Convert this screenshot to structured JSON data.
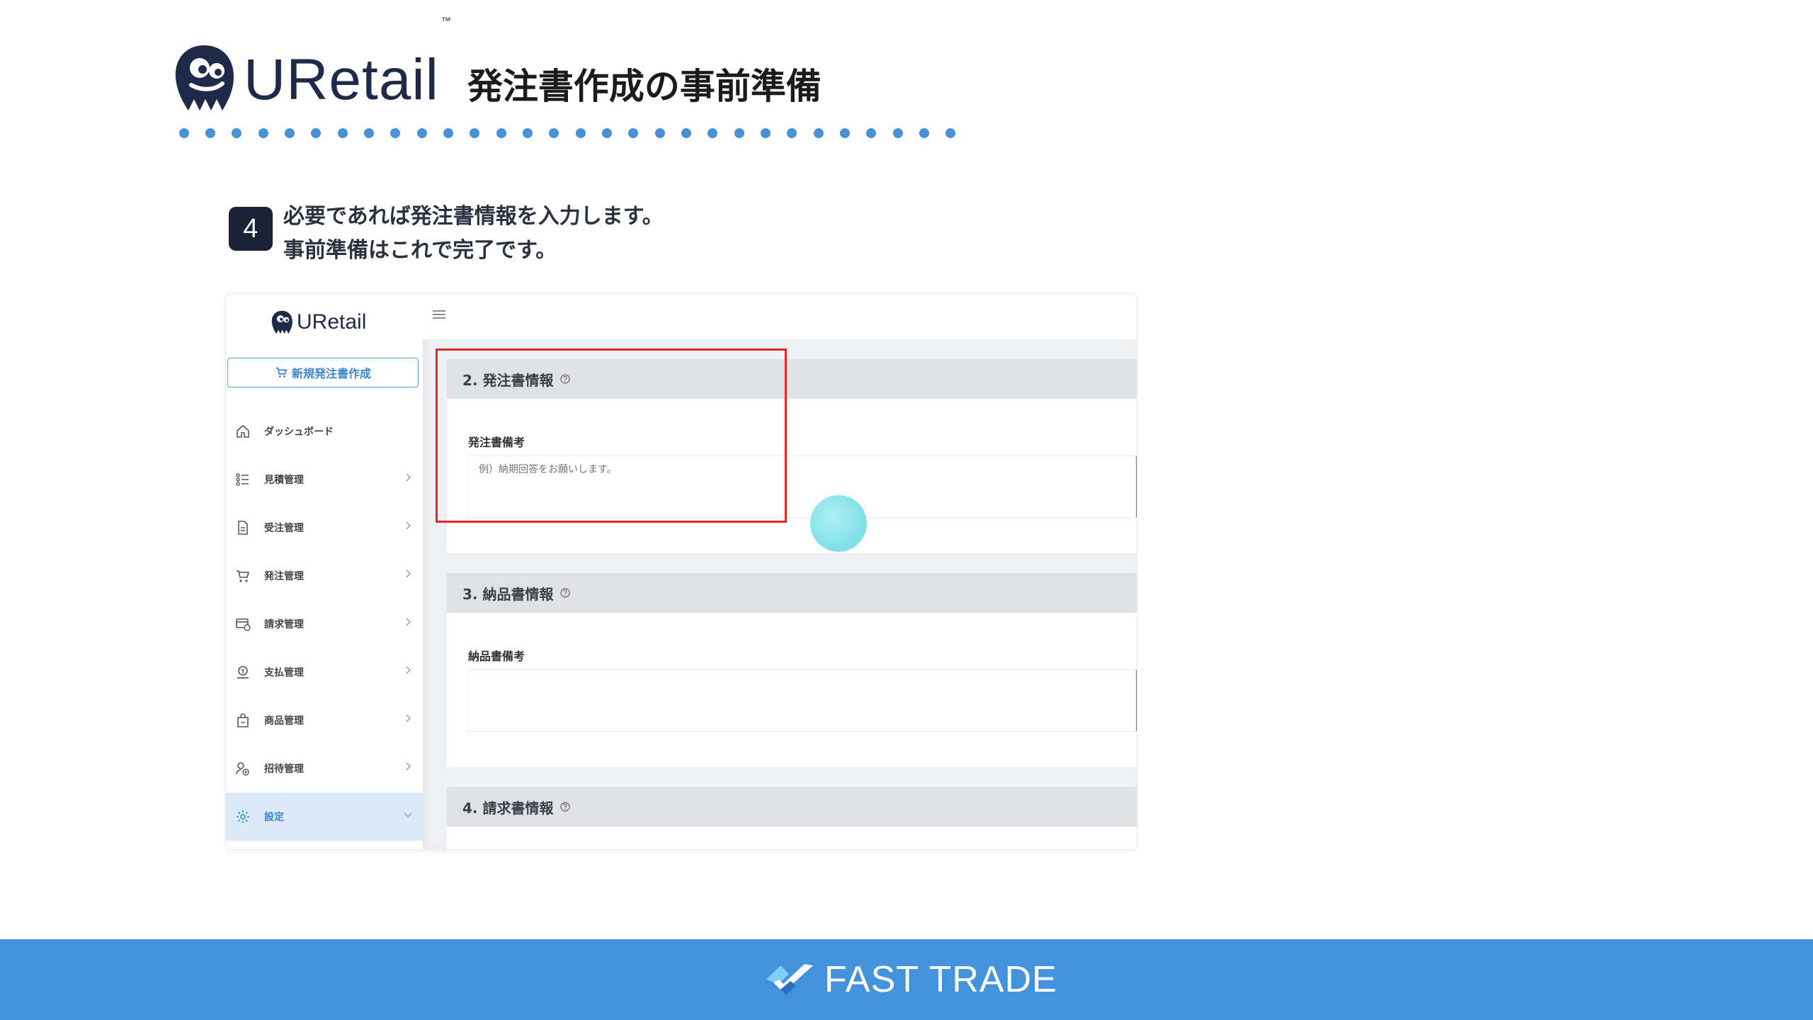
{
  "slide": {
    "brand": "URetail",
    "trademark": "™",
    "title": "発注書作成の事前準備",
    "step_number": "4",
    "instruction_line1": "必要であれば発注書情報を入力します。",
    "instruction_line2": "事前準備はこれで完了です。"
  },
  "app": {
    "logo_text": "URetail",
    "new_order_button": "新規発注書作成",
    "nav": [
      {
        "label": "ダッシュボード",
        "icon": "home-icon",
        "has_chevron": false,
        "active": false
      },
      {
        "label": "見積管理",
        "icon": "list-icon",
        "has_chevron": true,
        "active": false
      },
      {
        "label": "受注管理",
        "icon": "document-icon",
        "has_chevron": true,
        "active": false
      },
      {
        "label": "発注管理",
        "icon": "cart-icon",
        "has_chevron": true,
        "active": false
      },
      {
        "label": "請求管理",
        "icon": "invoice-icon",
        "has_chevron": true,
        "active": false
      },
      {
        "label": "支払管理",
        "icon": "payment-icon",
        "has_chevron": true,
        "active": false
      },
      {
        "label": "商品管理",
        "icon": "product-bag-icon",
        "has_chevron": true,
        "active": false
      },
      {
        "label": "招待管理",
        "icon": "invite-user-icon",
        "has_chevron": true,
        "active": false
      },
      {
        "label": "設定",
        "icon": "gear-icon",
        "has_chevron": true,
        "active": true
      }
    ],
    "sections": {
      "order_info": {
        "title": "2. 発注書情報",
        "field_label": "発注書備考",
        "field_placeholder": "例）納期回答をお願いします。",
        "field_value": ""
      },
      "delivery_info": {
        "title": "3. 納品書情報",
        "field_label": "納品書備考",
        "field_placeholder": "",
        "field_value": ""
      },
      "invoice_info": {
        "title": "4. 請求書情報"
      }
    }
  },
  "footer": {
    "brand": "FAST TRADE"
  },
  "colors": {
    "accent": "#4393dc",
    "highlight": "#e32626",
    "dots": "#4a90d9",
    "nav_active_bg": "#dce9f7"
  }
}
